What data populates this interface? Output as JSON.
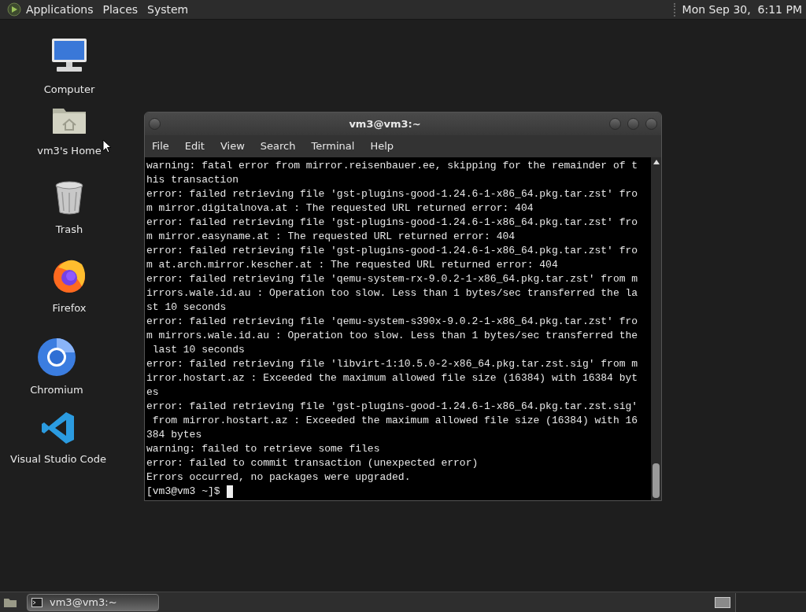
{
  "top_panel": {
    "menus": [
      "Applications",
      "Places",
      "System"
    ],
    "clock": "Mon Sep 30,  6:11 PM"
  },
  "desktop_icons": [
    {
      "kind": "computer",
      "label": "Computer"
    },
    {
      "kind": "home",
      "label": "vm3's Home"
    },
    {
      "kind": "trash",
      "label": "Trash"
    },
    {
      "kind": "firefox",
      "label": "Firefox"
    },
    {
      "kind": "chromium",
      "label": "Chromium"
    },
    {
      "kind": "vscode",
      "label": "Visual Studio Code"
    }
  ],
  "terminal": {
    "title": "vm3@vm3:~",
    "menu": [
      "File",
      "Edit",
      "View",
      "Search",
      "Terminal",
      "Help"
    ],
    "lines": [
      "warning: fatal error from mirror.reisenbauer.ee, skipping for the remainder of t",
      "his transaction",
      "error: failed retrieving file 'gst-plugins-good-1.24.6-1-x86_64.pkg.tar.zst' fro",
      "m mirror.digitalnova.at : The requested URL returned error: 404",
      "error: failed retrieving file 'gst-plugins-good-1.24.6-1-x86_64.pkg.tar.zst' fro",
      "m mirror.easyname.at : The requested URL returned error: 404",
      "error: failed retrieving file 'gst-plugins-good-1.24.6-1-x86_64.pkg.tar.zst' fro",
      "m at.arch.mirror.kescher.at : The requested URL returned error: 404",
      "error: failed retrieving file 'qemu-system-rx-9.0.2-1-x86_64.pkg.tar.zst' from m",
      "irrors.wale.id.au : Operation too slow. Less than 1 bytes/sec transferred the la",
      "st 10 seconds",
      "error: failed retrieving file 'qemu-system-s390x-9.0.2-1-x86_64.pkg.tar.zst' fro",
      "m mirrors.wale.id.au : Operation too slow. Less than 1 bytes/sec transferred the",
      " last 10 seconds",
      "error: failed retrieving file 'libvirt-1:10.5.0-2-x86_64.pkg.tar.zst.sig' from m",
      "irror.hostart.az : Exceeded the maximum allowed file size (16384) with 16384 byt",
      "es",
      "error: failed retrieving file 'gst-plugins-good-1.24.6-1-x86_64.pkg.tar.zst.sig'",
      " from mirror.hostart.az : Exceeded the maximum allowed file size (16384) with 16",
      "384 bytes",
      "warning: failed to retrieve some files",
      "error: failed to commit transaction (unexpected error)",
      "Errors occurred, no packages were upgraded."
    ],
    "prompt": "[vm3@vm3 ~]$"
  },
  "taskbar": {
    "tasks": [
      {
        "label": "vm3@vm3:~",
        "selected": true
      }
    ]
  }
}
